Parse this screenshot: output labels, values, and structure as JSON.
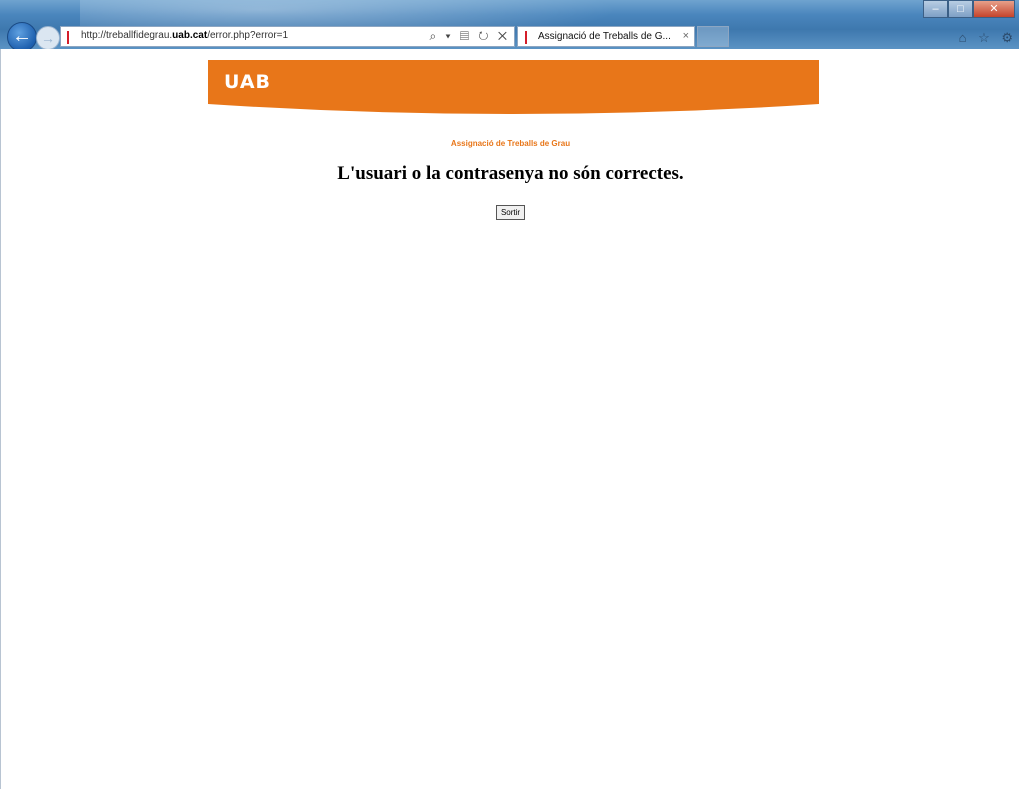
{
  "browser": {
    "url_prefix": "http://treballfidegrau.",
    "url_domain": "uab.cat",
    "url_suffix": "/error.php?error=1",
    "address_tools": "⌕ ▾ ▤ ↻ ✕",
    "tab_title": "Assignació de Treballs de G...",
    "tab_close": "×",
    "window_controls": {
      "minimize": "–",
      "maximize": "□",
      "close": "✕"
    },
    "right_icons": "⌂ ☆ ⚙",
    "back_label": "←",
    "forward_label": "→"
  },
  "page": {
    "logo_text": "UAB",
    "subtitle": "Assignació de Treballs de Grau",
    "error_message": "L'usuari o la contrasenya no són correctes.",
    "exit_button": "Sortir"
  },
  "colors": {
    "brand_orange": "#e87619",
    "browser_chrome": "#4a86bd"
  }
}
